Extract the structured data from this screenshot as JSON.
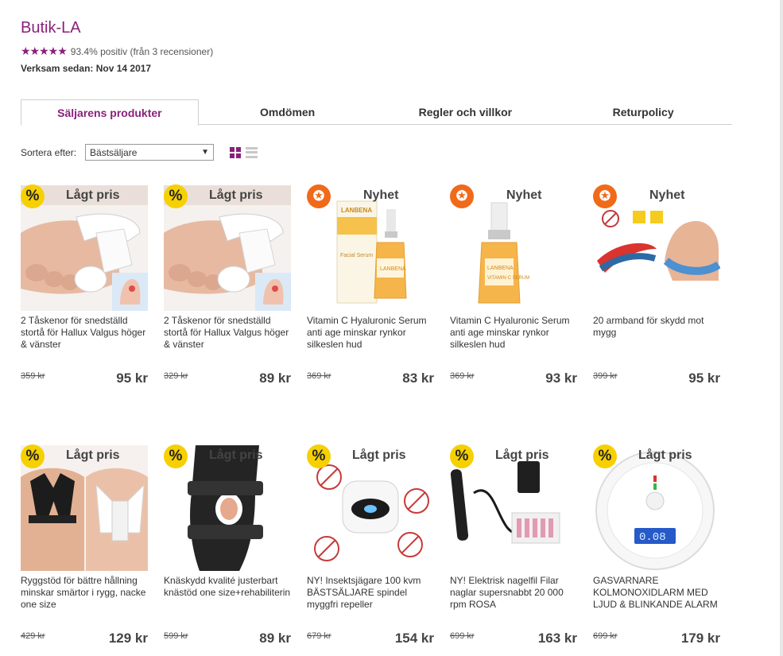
{
  "shop": {
    "name": "Butik-LA",
    "stars": "★★★★★",
    "rating_text": "93.4% positiv (från 3 recensioner)",
    "since": "Verksam sedan: Nov 14 2017"
  },
  "tabs": [
    "Säljarens produkter",
    "Omdömen",
    "Regler och villkor",
    "Returpolicy"
  ],
  "sort": {
    "label": "Sortera efter:",
    "value": "Bästsäljare"
  },
  "badges": {
    "sale_symbol": "%",
    "new_symbol": "✪",
    "sale_text": "Lågt pris",
    "new_text": "Nyhet"
  },
  "products": [
    {
      "badge": "sale",
      "badge_text": "Lågt pris",
      "title": "2 Tåskenor för snedställd stortå för Hallux Valgus höger & vänster",
      "old_price": "359 kr",
      "price": "95 kr",
      "image": "toe-splint"
    },
    {
      "badge": "sale",
      "badge_text": "Lågt pris",
      "title": "2 Tåskenor för snedställd stortå för Hallux Valgus höger & vänster",
      "old_price": "329 kr",
      "price": "89 kr",
      "image": "toe-splint"
    },
    {
      "badge": "new",
      "badge_text": "Nyhet",
      "title": "Vitamin C Hyaluronic Serum anti age minskar rynkor silkeslen hud",
      "old_price": "369 kr",
      "price": "83 kr",
      "image": "serum-box"
    },
    {
      "badge": "new",
      "badge_text": "Nyhet",
      "title": "Vitamin C Hyaluronic Serum anti age minskar rynkor silkeslen hud",
      "old_price": "369 kr",
      "price": "93 kr",
      "image": "serum-bottle"
    },
    {
      "badge": "new",
      "badge_text": "Nyhet",
      "title": "20 armband för skydd mot mygg",
      "old_price": "399 kr",
      "price": "95 kr",
      "image": "wristband"
    },
    {
      "badge": "sale",
      "badge_text": "Lågt pris",
      "title": "Ryggstöd för bättre hållning minskar smärtor i rygg, nacke one size",
      "old_price": "429 kr",
      "price": "129 kr",
      "image": "posture"
    },
    {
      "badge": "sale",
      "badge_text": "Lågt pris",
      "title": "Knäskydd kvalité justerbart knästöd one size+rehabiliterin",
      "old_price": "599 kr",
      "price": "89 kr",
      "image": "knee"
    },
    {
      "badge": "sale",
      "badge_text": "Lågt pris",
      "title": "NY! Insektsjägare 100 kvm BÄSTSÄLJARE spindel myggfri repeller",
      "old_price": "679 kr",
      "price": "154 kr",
      "image": "repeller"
    },
    {
      "badge": "sale",
      "badge_text": "Lågt pris",
      "title": "NY! Elektrisk nagelfil Filar naglar supersnabbt 20 000 rpm ROSA",
      "old_price": "699 kr",
      "price": "163 kr",
      "image": "nailfile"
    },
    {
      "badge": "sale",
      "badge_text": "Lågt pris",
      "title": "GASVARNARE KOLMONOXIDLARM MED LJUD & BLINKANDE ALARM",
      "old_price": "699 kr",
      "price": "179 kr",
      "image": "co-alarm"
    }
  ],
  "image_texts": {
    "serum_brand": "LANBENA",
    "serum_label": "Facial Serum",
    "serum_vc": "VITAMIN C SERUM",
    "alarm_display": "0.08"
  },
  "colors": {
    "brand": "#8a1f7c",
    "sale_badge": "#f6d000",
    "new_badge": "#f06a1a"
  }
}
